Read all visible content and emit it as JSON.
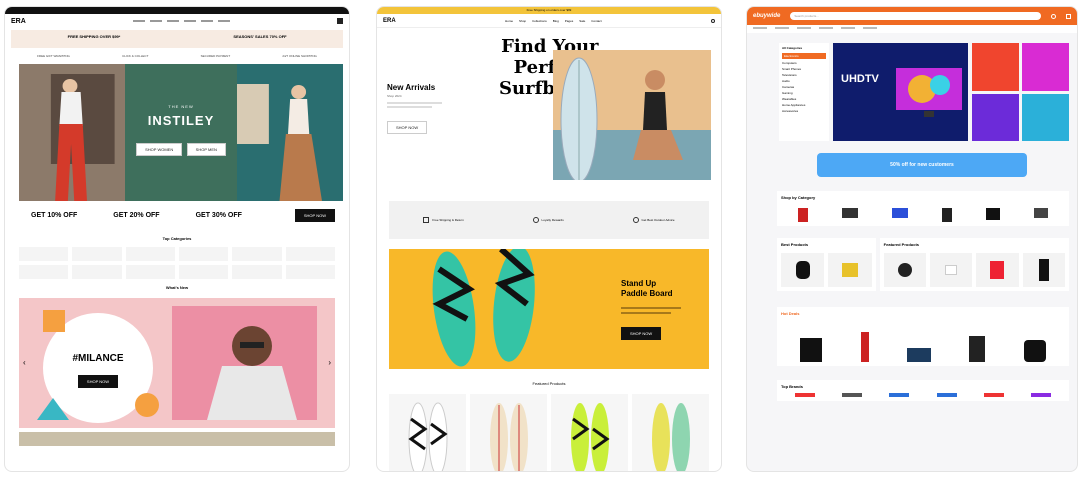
{
  "f1": {
    "logo": "ERA",
    "banner1": "FREE SHIPPING OVER $99*",
    "banner2": "SEASONS' SALES 70% OFF",
    "features": [
      "FREE GIFT WRAPPING",
      "CLICK & COLLECT",
      "SECURED PAYMENT",
      "24/7 ONLINE SHOPPING"
    ],
    "hero_kicker": "THE NEW",
    "hero_title": "INSTILEY",
    "hero_btn1": "SHOP WOMEN",
    "hero_btn2": "SHOP MEN",
    "offers": [
      "GET 10% OFF",
      "GET 20% OFF",
      "GET 30% OFF"
    ],
    "shop_now": "SHOP NOW",
    "top_categories": "Top Categories",
    "whats_new": "What's New",
    "promo_title": "#MILANCE",
    "promo_btn": "SHOP NOW",
    "colors": {
      "green": "#3e6f5c",
      "teal": "#2d7a7c",
      "pink": "#f4c6c8"
    }
  },
  "f2": {
    "topbar": "Free Shipping on orders over $99",
    "logo": "ERA",
    "nav": [
      "Home",
      "Shop",
      "Collections",
      "Blog",
      "Pages",
      "Sale",
      "Contact"
    ],
    "new_arrivals": "New Arrivals",
    "new_arrivals_sub": "Shop 2024",
    "hero_title": [
      "Find Your",
      "Perfect",
      "Surfboard"
    ],
    "shop_btn": "SHOP NOW",
    "features": [
      "Free Shipping & Return",
      "Loyalty Rewards",
      "Get Best Outdoor Advice"
    ],
    "sup_title": [
      "Stand Up",
      "Paddle Board"
    ],
    "featured": "Featured Products",
    "colors": {
      "topbar": "#f3c43a",
      "yellow": "#f8b829",
      "teal": "#34c4a5"
    }
  },
  "f3": {
    "logo": "ebuywide",
    "search_placeholder": "Search products...",
    "sidebar_title": "All Categories",
    "sidebar_items": [
      "Electronics",
      "Computers",
      "Smart Phones",
      "Televisions",
      "Audio",
      "Cameras",
      "Gaming",
      "Wearables",
      "Home Appliances",
      "Accessories"
    ],
    "hero_title": "UHDTV",
    "promo": "50% off for new customers",
    "section1": "Shop by Category",
    "section2": "Best Products",
    "section3": "Featured Products",
    "deals": "Hot Deals",
    "brands": "Top Brands",
    "colors": {
      "orange": "#f06a22",
      "navy": "#0f1c6c",
      "blue": "#4da8f5"
    }
  }
}
